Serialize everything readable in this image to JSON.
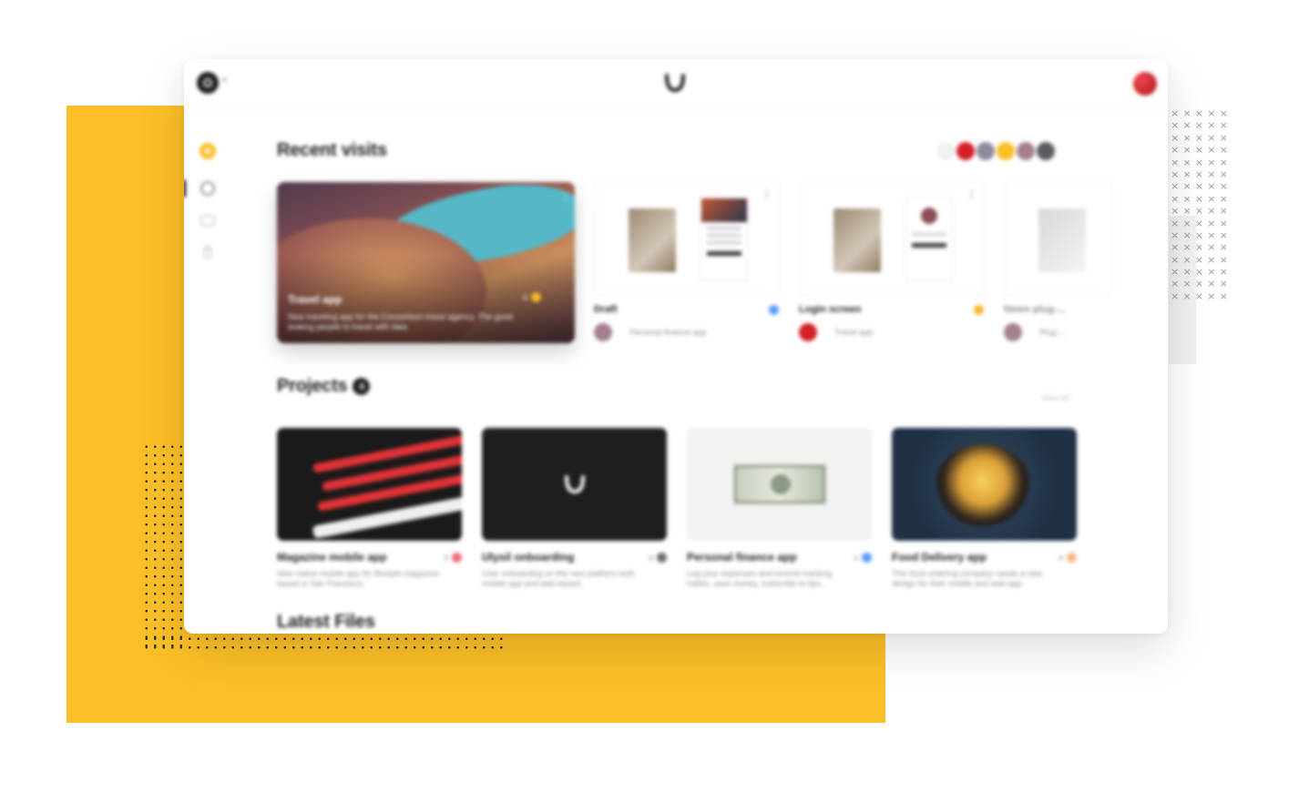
{
  "colors": {
    "yellow_accent": "#fbbf27",
    "dark": "#1d1d1f",
    "avatar_red": "#d21f27",
    "blue_dot": "#5a9cf5",
    "orange_dot": "#f5b82e"
  },
  "topbar": {
    "workspace_icon": "workspace-circle-icon",
    "logo_icon": "u-logo-icon",
    "avatar_icon": "user-avatar"
  },
  "sidebar": {
    "items": [
      {
        "icon": "home-icon"
      },
      {
        "icon": "circle-icon"
      },
      {
        "icon": "folder-icon"
      },
      {
        "icon": "trash-icon"
      }
    ]
  },
  "recent": {
    "title": "Recent visits",
    "hero": {
      "title": "Travel app",
      "desc": "New traveling app for the Consortium travel agency. The good looking people to travel with idea.",
      "count": "4"
    },
    "cards": [
      {
        "title": "Draft",
        "project": "Personal finance app"
      },
      {
        "title": "Login screen",
        "project": "Travel app"
      },
      {
        "title": "News plug-...",
        "project": "Plug-..."
      }
    ]
  },
  "projects": {
    "title": "Projects",
    "count": "4",
    "view_all": "View all",
    "items": [
      {
        "title": "Magazine mobile app",
        "desc": "New native mobile app for lifestyle magazine based in San Francisco.",
        "count": "4"
      },
      {
        "title": "Ulysil onboarding",
        "desc": "User onboarding on the new platform both mobile app and web-based.",
        "count": "4"
      },
      {
        "title": "Personal finance app",
        "desc": "Log your expenses and income tracking habits, save money, subscribe to tips...",
        "count": "4"
      },
      {
        "title": "Food Delivery app",
        "desc": "This food ordering company needs a new design for their mobile and web app.",
        "count": "4"
      }
    ]
  },
  "latest": {
    "title": "Latest Files"
  }
}
